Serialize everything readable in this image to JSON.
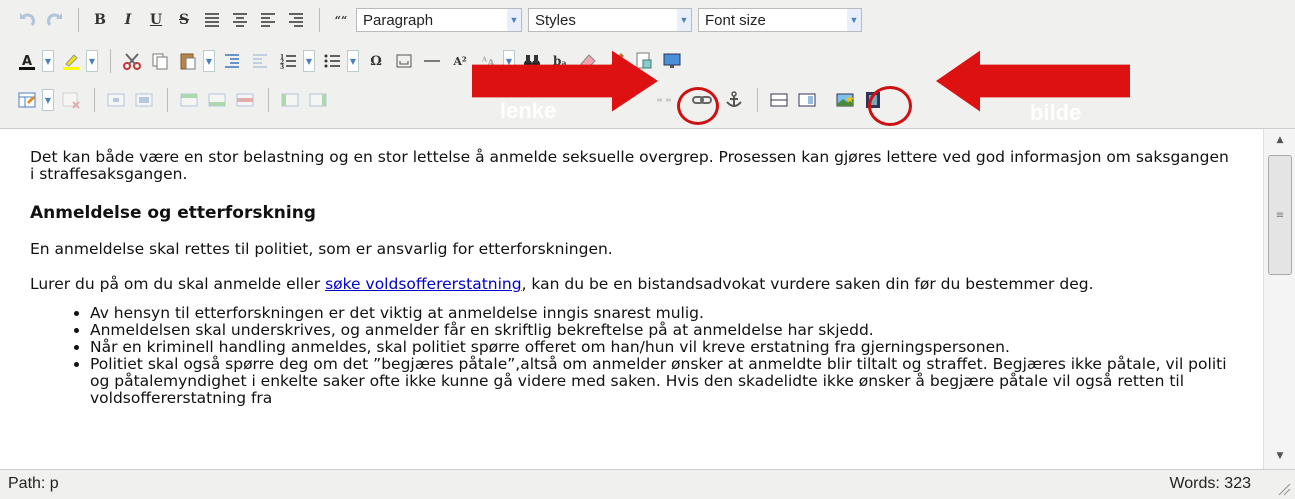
{
  "toolbar": {
    "format_select": "Paragraph",
    "styles_select": "Styles",
    "fontsize_select": "Font size",
    "bold_label": "B",
    "italic_label": "I",
    "underline_label": "U",
    "strike_label": "S",
    "quote_label": "““",
    "superscript_label": "A²",
    "abbr_label": "bₐ"
  },
  "content": {
    "intro": "Det kan både være en stor belastning og en stor lettelse å anmelde seksuelle overgrep. Prosessen kan gjøres lettere ved god informasjon om saksgangen i straffesaksgangen.",
    "heading": "Anmeldelse og etterforskning",
    "para1": "En anmeldelse skal rettes til politiet, som er ansvarlig for etterforskningen.",
    "para2_before": "Lurer du på om du skal anmelde eller ",
    "para2_link": "søke voldsoffererstatning",
    "para2_after": ", kan du be en bistandsadvokat vurdere saken din før du bestemmer deg.",
    "bullets": [
      "Av hensyn til etterforskningen er det viktig at anmeldelse inngis snarest mulig.",
      "Anmeldelsen skal underskrives, og anmelder får en skriftlig bekreftelse på at anmeldelse har skjedd.",
      "Når en kriminell handling anmeldes, skal politiet spørre offeret om han/hun vil kreve erstatning fra gjerningspersonen.",
      "Politiet skal også spørre deg om det ”begjæres påtale”,altså om anmelder ønsker at anmeldte blir tiltalt og straffet. Begjæres ikke påtale, vil politi og påtalemyndighet i enkelte saker ofte ikke kunne gå videre med saken. Hvis den skadelidte ikke ønsker å begjære påtale vil også retten til voldsoffererstatning fra"
    ]
  },
  "status": {
    "path": "Path: p",
    "words": "Words: 323"
  },
  "annotations": {
    "left_label": "lenke",
    "right_label": "bilde",
    "arrow_color": "#dd1111"
  }
}
